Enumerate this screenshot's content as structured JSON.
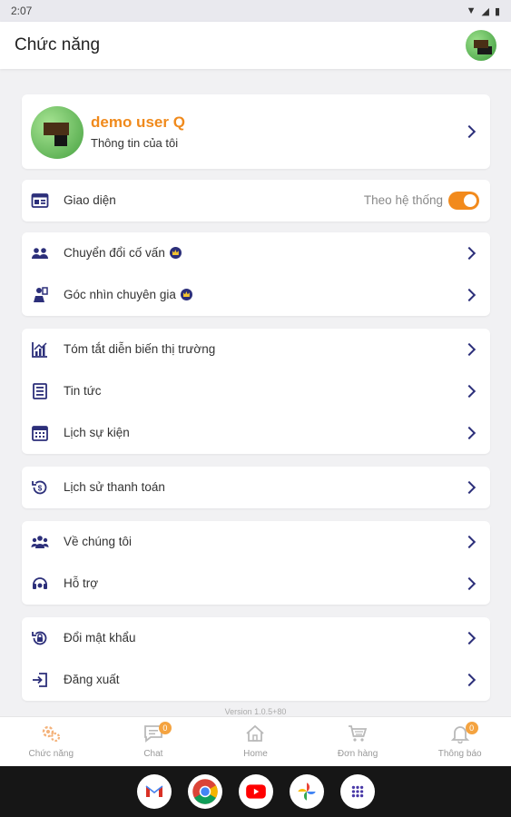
{
  "status_bar": {
    "time": "2:07"
  },
  "app_bar": {
    "title": "Chức năng"
  },
  "profile": {
    "name": "demo user Q",
    "subtitle": "Thông tin của tôi"
  },
  "appearance": {
    "label": "Giao diện",
    "toggle_label": "Theo hệ thống",
    "toggle_on": true
  },
  "menu": {
    "advisor_switch": "Chuyển đổi cố vấn",
    "expert_view": "Góc nhìn chuyên gia",
    "market_summary": "Tóm tắt diễn biến thị trường",
    "news": "Tin tức",
    "event_calendar": "Lịch sự kiện",
    "payment_history": "Lịch sử thanh toán",
    "about_us": "Về chúng tôi",
    "support": "Hỗ trợ",
    "change_password": "Đổi mật khẩu",
    "logout": "Đăng xuất"
  },
  "version": "Version 1.0.5+80",
  "bottom_nav": {
    "features": "Chức năng",
    "chat": "Chat",
    "chat_badge": "0",
    "home": "Home",
    "orders": "Đơn hàng",
    "notifications": "Thông báo",
    "notifications_badge": "0"
  },
  "colors": {
    "accent": "#f08a1c",
    "icon": "#2c2f7a",
    "background": "#f1f1f3"
  }
}
